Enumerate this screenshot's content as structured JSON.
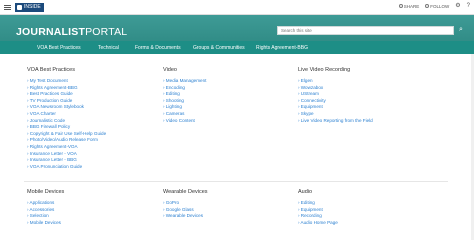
{
  "topbar": {
    "inside_label": "INSIDE",
    "share_label": "SHARE",
    "follow_label": "FOLLOW"
  },
  "header": {
    "logo_bold": "JOURNALIST",
    "logo_light": "PORTAL",
    "search_placeholder": "Search this site"
  },
  "nav": {
    "items": [
      "VOA Best Practices",
      "Technical",
      "Forms & Documents",
      "Groups & Communities",
      "Rights Agreement-BBG"
    ]
  },
  "sections": {
    "voa_best_practices": {
      "title": "VOA Best Practices",
      "links": [
        "My Test Document",
        "Rights Agreement-BBG",
        "Best Practices Guide",
        "TV Production Guide",
        "VOA Newsroom Stylebook",
        "VOA Charter",
        "Journalistic Code",
        "BBG Firewall Policy",
        "Copyright & Fair Use Self-Help Guide",
        "Photo/Video/Audio Release Form",
        "Rights Agreement-VOA",
        "Insurance Letter - VOA",
        "Insurance Letter - BBG",
        "VOA Pronunciation Guide"
      ]
    },
    "video": {
      "title": "Video",
      "links": [
        "Media Management",
        "Encoding",
        "Editing",
        "Shooting",
        "Lighting",
        "Cameras",
        "Video Content"
      ]
    },
    "live_video": {
      "title": "Live Video Recording",
      "links": [
        "Elgen",
        "Wowzabox",
        "UStream",
        "Connectivity",
        "Equipment",
        "Skype",
        "Live Video Reporting from the Field"
      ]
    },
    "mobile": {
      "title": "Mobile Devices",
      "links": [
        "Applications",
        "Accessories",
        "Selection",
        "Mobile Devices"
      ]
    },
    "wearable": {
      "title": "Wearable Devices",
      "links": [
        "GoPro",
        "Google Glass",
        "Wearable Devices"
      ]
    },
    "audio": {
      "title": "Audio",
      "links": [
        "Editing",
        "Equipment",
        "Recording",
        "Audio Home Page"
      ]
    }
  }
}
